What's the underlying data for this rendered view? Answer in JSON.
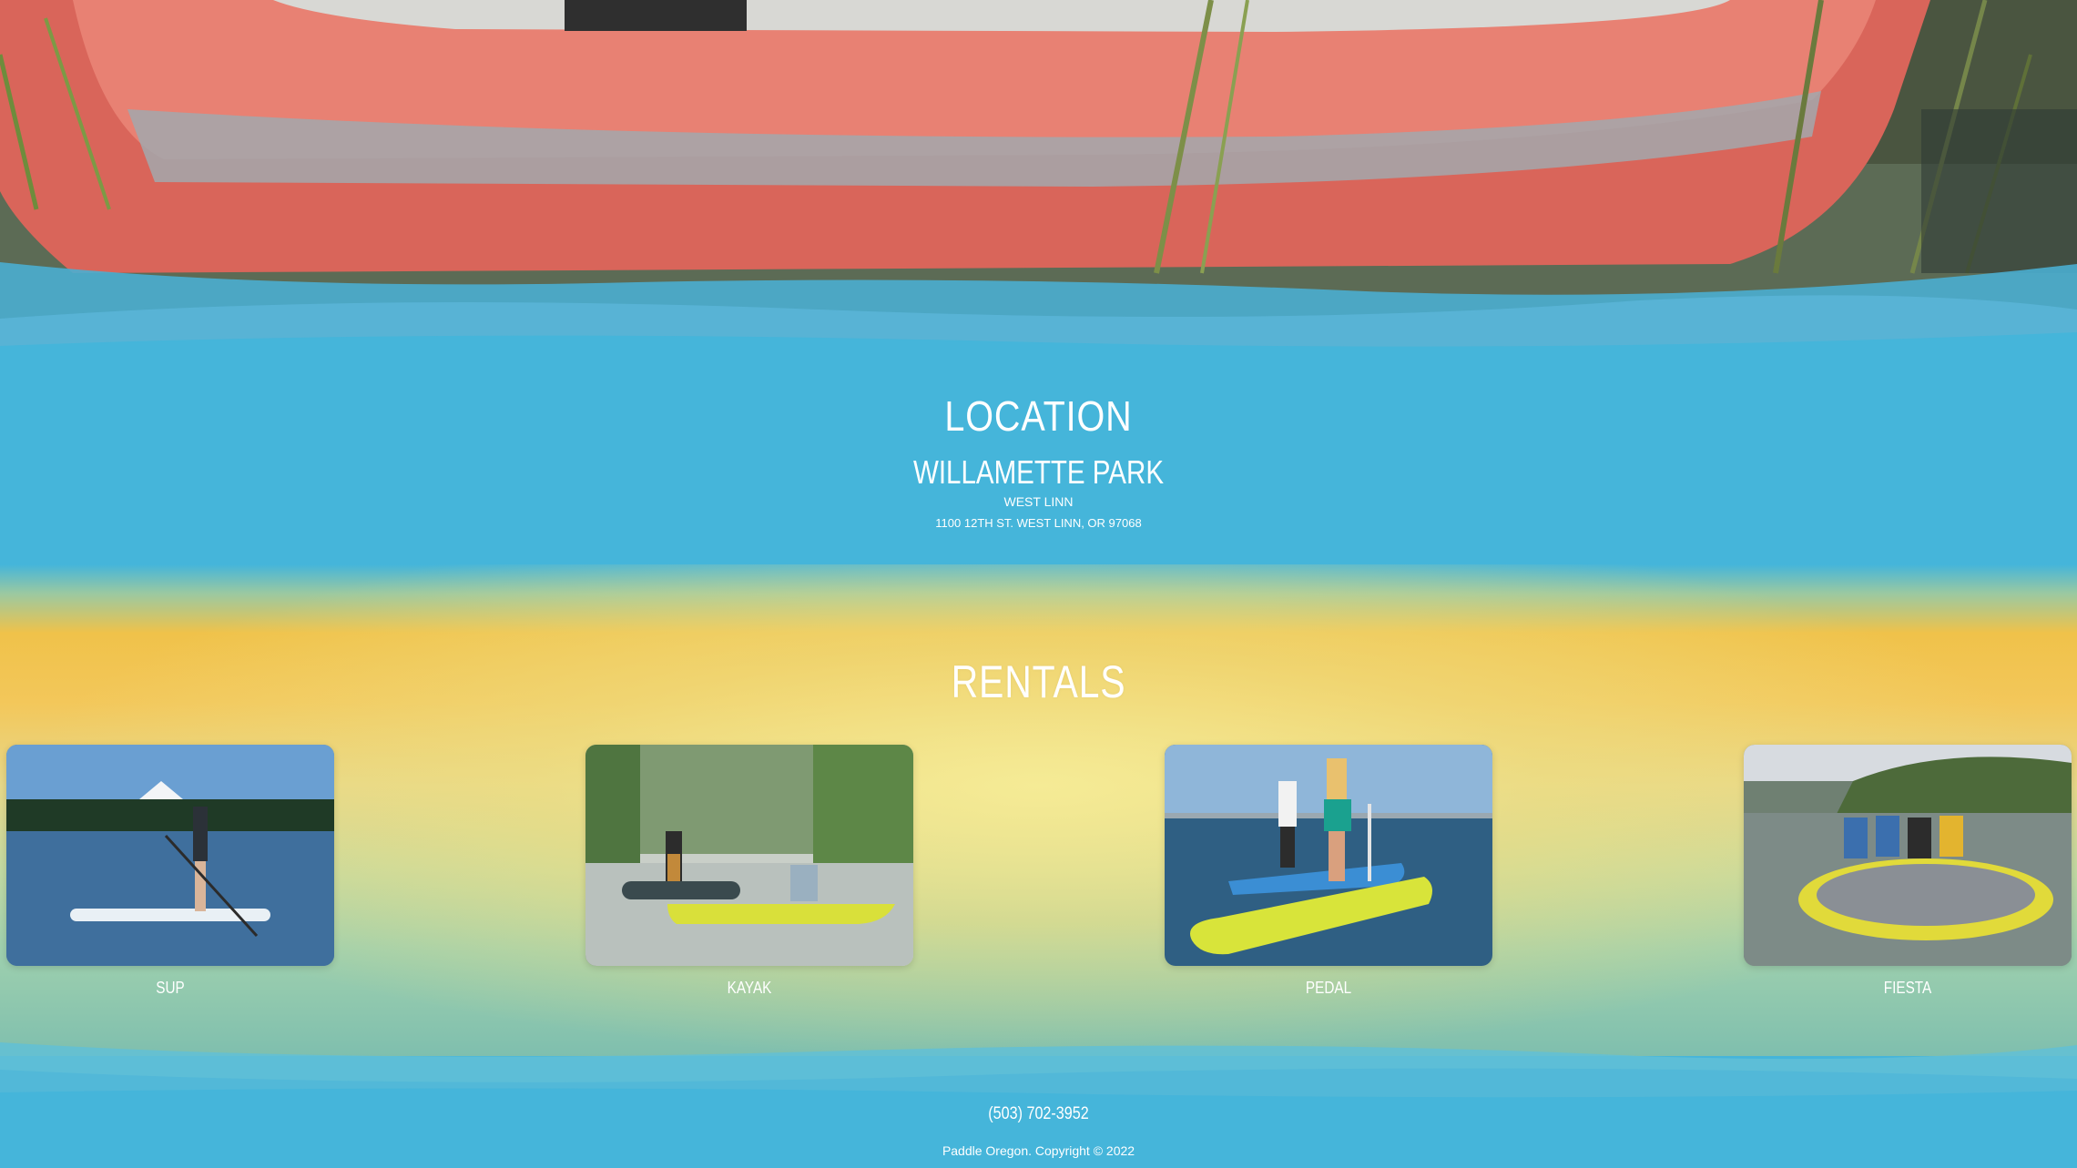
{
  "location": {
    "heading": "LOCATION",
    "park": "WILLAMETTE PARK",
    "city": "WEST LINN",
    "address": "1100 12TH ST. WEST LINN, OR 97068"
  },
  "rentals": {
    "title": "RENTALS",
    "items": [
      {
        "label": "SUP",
        "image": "paddleboarder-on-mountain-lake-photo"
      },
      {
        "label": "KAYAK",
        "image": "kayakers-on-river-photo"
      },
      {
        "label": "PEDAL",
        "image": "pedal-boards-on-lake-photo"
      },
      {
        "label": "FIESTA",
        "image": "group-on-inflatable-board-photo"
      }
    ]
  },
  "footer": {
    "phone": "(503) 702-3952",
    "copyright": "Paddle Oregon. Copyright © 2022"
  },
  "colors": {
    "water_blue": "#45b5da",
    "sunset_yellow": "#f3c75a",
    "kayak_red": "#e06a5a"
  }
}
